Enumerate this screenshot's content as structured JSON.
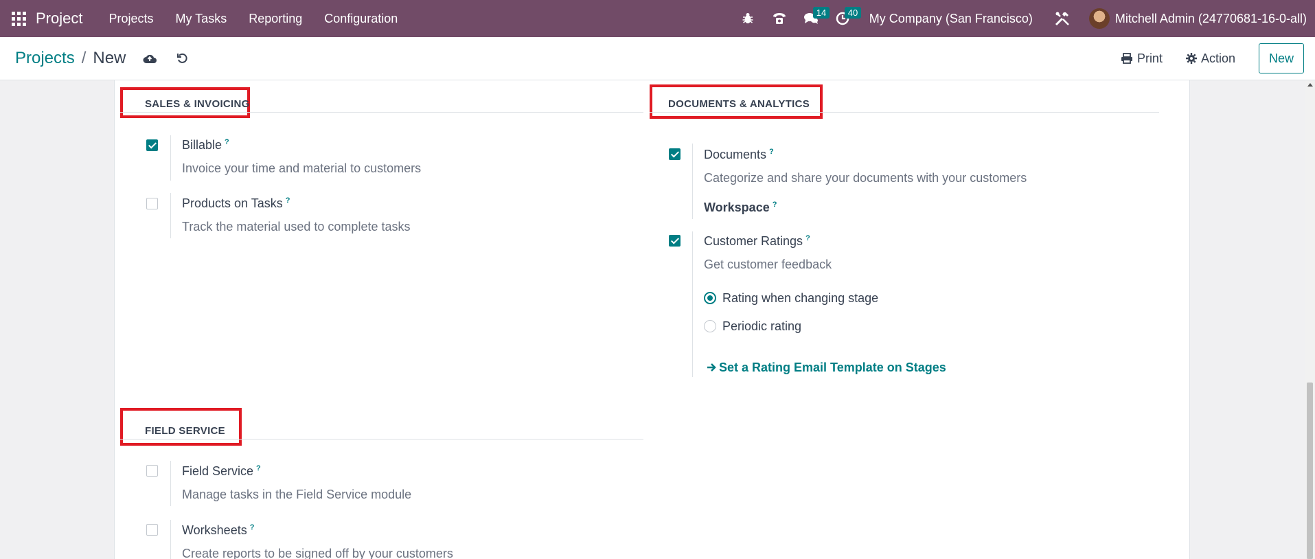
{
  "navbar": {
    "brand": "Project",
    "menu": [
      "Projects",
      "My Tasks",
      "Reporting",
      "Configuration"
    ],
    "messages_count": "14",
    "activities_count": "40",
    "company": "My Company (San Francisco)",
    "user": "Mitchell Admin (24770681-16-0-all)"
  },
  "control": {
    "breadcrumb_parent": "Projects",
    "breadcrumb_sep": "/",
    "breadcrumb_current": "New",
    "print_label": "Print",
    "action_label": "Action",
    "new_label": "New"
  },
  "sections": {
    "sales": {
      "title": "SALES & INVOICING",
      "billable": {
        "label": "Billable",
        "help": "?",
        "desc": "Invoice your time and material to customers",
        "checked": true
      },
      "products": {
        "label": "Products on Tasks",
        "help": "?",
        "desc": "Track the material used to complete tasks",
        "checked": false
      }
    },
    "documents": {
      "title": "DOCUMENTS & ANALYTICS",
      "documents": {
        "label": "Documents",
        "help": "?",
        "desc": "Categorize and share your documents with your customers",
        "checked": true
      },
      "workspace": {
        "label": "Workspace",
        "help": "?"
      },
      "ratings": {
        "label": "Customer Ratings",
        "help": "?",
        "desc": "Get customer feedback",
        "checked": true
      },
      "rating_options": [
        "Rating when changing stage",
        "Periodic rating"
      ],
      "rating_selected": "Rating when changing stage",
      "template_link": "Set a Rating Email Template on Stages"
    },
    "field_service": {
      "title": "FIELD SERVICE",
      "field_service": {
        "label": "Field Service",
        "help": "?",
        "desc": "Manage tasks in the Field Service module",
        "checked": false
      },
      "worksheets": {
        "label": "Worksheets",
        "help": "?",
        "desc": "Create reports to be signed off by your customers",
        "checked": false
      }
    }
  },
  "colors": {
    "navbar": "#714b67",
    "accent": "#017e84",
    "highlight_box": "#e01b24"
  }
}
